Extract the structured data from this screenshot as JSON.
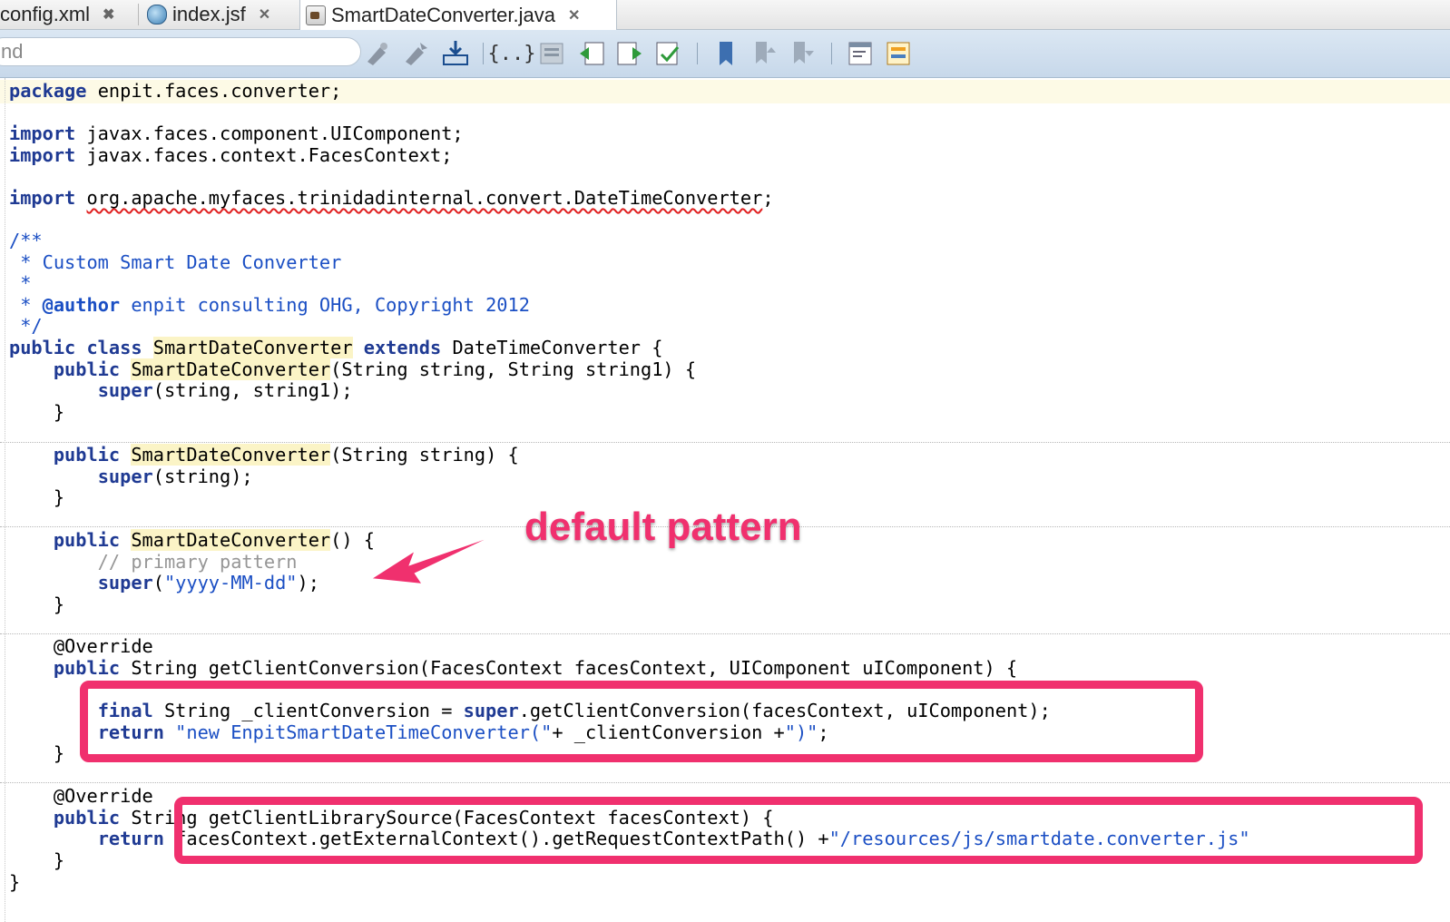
{
  "tabs": [
    {
      "label": "config.xml",
      "close": "✖",
      "icon": "xml-file-icon"
    },
    {
      "label": "index.jsf",
      "close": "✕",
      "icon": "jsf-file-icon"
    },
    {
      "label": "SmartDateConverter.java",
      "close": "✕",
      "icon": "java-file-icon",
      "active": true
    }
  ],
  "toolbar": {
    "search_text": "nd",
    "icons": [
      "history-back-icon",
      "history-forward-icon",
      "last-edit-icon",
      "code-braces-icon",
      "toggle-comment-icon",
      "shift-left-icon",
      "shift-right-icon",
      "format-icon",
      "bookmark-icon",
      "prev-bookmark-icon",
      "next-bookmark-icon",
      "macro-icon",
      "diff-icon"
    ]
  },
  "code": {
    "l1_kw": "package",
    "l1_rest": " enpit.faces.converter;",
    "l2_kw": "import",
    "l2_rest": " javax.faces.component.UIComponent;",
    "l3_kw": "import",
    "l3_rest": " javax.faces.context.FacesContext;",
    "l4_kw": "import",
    "l4_space": " ",
    "l4_err": "org.apache.myfaces.trinidadinternal.convert.DateTimeConverter",
    "l4_end": ";",
    "c1": "/**",
    "c2": " * Custom Smart Date Converter",
    "c3": " *",
    "c4_a": " * ",
    "c4_tag": "@author",
    "c4_b": " enpit consulting OHG, Copyright 2012",
    "c5": " */",
    "cls_kw1": "public class",
    "cls_sp": " ",
    "cls_name": "SmartDateConverter",
    "cls_kw2": " extends",
    "cls_rest": " DateTimeConverter {",
    "m1_ind": "    ",
    "m1_kw": "public",
    "m1_sp": " ",
    "m1_name": "SmartDateConverter",
    "m1_rest": "(String string, String string1) {",
    "m1b_ind": "        ",
    "m1b_kw": "super",
    "m1b_rest": "(string, string1);",
    "m1c": "    }",
    "m2_ind": "    ",
    "m2_kw": "public",
    "m2_sp": " ",
    "m2_name": "SmartDateConverter",
    "m2_rest": "(String string) {",
    "m2b_ind": "        ",
    "m2b_kw": "super",
    "m2b_rest": "(string);",
    "m2c": "    }",
    "m3_ind": "    ",
    "m3_kw": "public",
    "m3_sp": " ",
    "m3_name": "SmartDateConverter",
    "m3_rest": "() {",
    "m3b": "        // primary pattern",
    "m3c_ind": "        ",
    "m3c_kw": "super",
    "m3c_open": "(",
    "m3c_str": "\"yyyy-MM-dd\"",
    "m3c_end": ");",
    "m3d": "    }",
    "o1": "    @Override",
    "o1b_ind": "    ",
    "o1b_kw": "public",
    "o1b_rest": " String getClientConversion(FacesContext facesContext, UIComponent uIComponent) {",
    "o1c_ind": "        ",
    "o1c_kw": "final",
    "o1c_a": " String _clientConversion = ",
    "o1c_kw2": "super",
    "o1c_b": ".getClientConversion(facesContext, uIComponent);",
    "o1d_ind": "        ",
    "o1d_kw": "return",
    "o1d_sp": " ",
    "o1d_str": "\"new EnpitSmartDateTimeConverter(\"",
    "o1d_a": "+ _clientConversion +",
    "o1d_str2": "\")\"",
    "o1d_end": ";",
    "o1e": "    }",
    "o2": "    @Override",
    "o2b_ind": "    ",
    "o2b_kw": "public",
    "o2b_rest": " String getClientLibrarySource(FacesContext facesContext) {",
    "o2c_ind": "        ",
    "o2c_kw": "return",
    "o2c_rest": " facesContext.getExternalContext().getRequestContextPath() +",
    "o2c_str": "\"/resources/js/smartdate.converter.js\"",
    "o2d": "    }",
    "end": "}"
  },
  "annotation": {
    "label": "default pattern"
  }
}
